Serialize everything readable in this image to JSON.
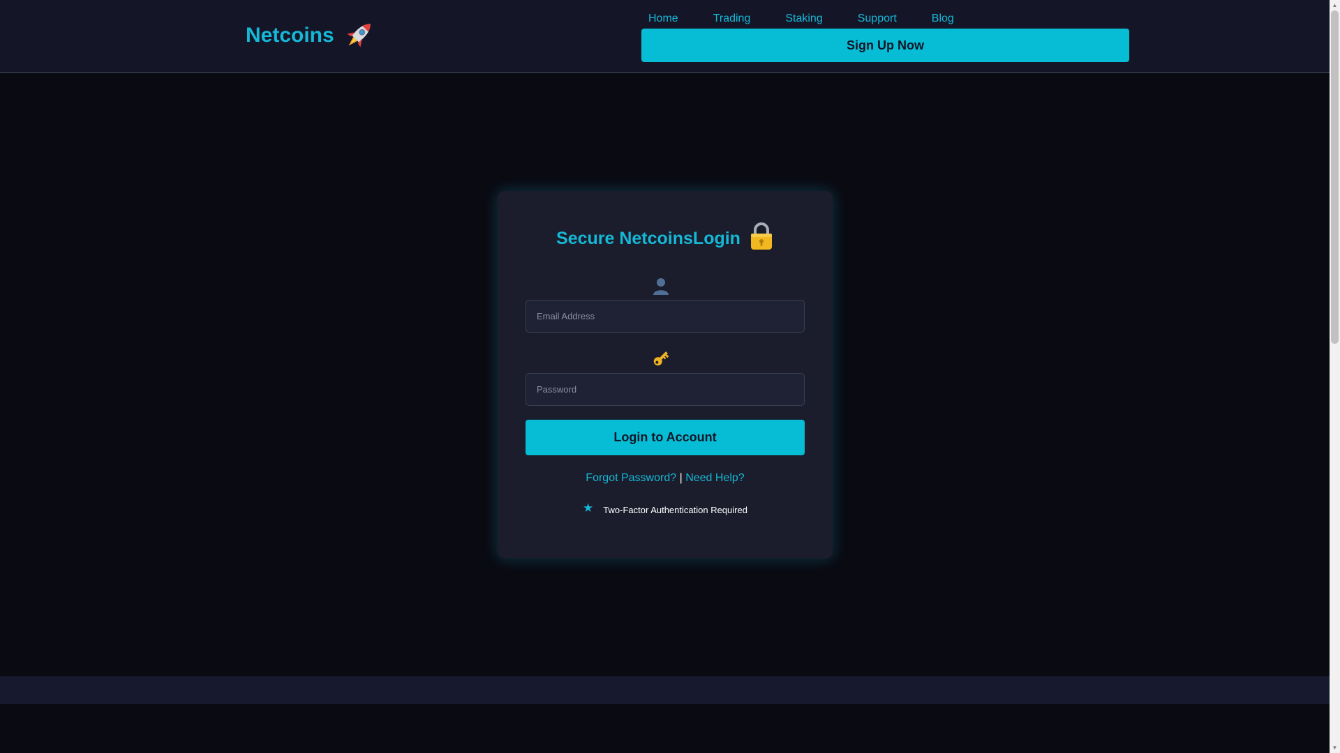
{
  "header": {
    "logo_text": "Netcoins",
    "nav": [
      "Home",
      "Trading",
      "Staking",
      "Support",
      "Blog"
    ],
    "signup_label": "Sign Up Now"
  },
  "login": {
    "title": "Secure NetcoinsLogin",
    "email_placeholder": "Email Address",
    "password_placeholder": "Password",
    "login_label": "Login to Account",
    "forgot_label": "Forgot Password?",
    "separator": "|",
    "help_label": "Need Help?",
    "tfa_text": "Two-Factor Authentication Required",
    "tfa_icon": "★"
  },
  "icons": {
    "logo": "rocket-icon",
    "title": "lock-icon",
    "email": "user-icon",
    "password": "key-icon",
    "tfa": "star-icon"
  },
  "colors": {
    "accent": "#15b8d6",
    "button": "#07bdd6",
    "header_bg": "#141628",
    "page_bg": "#0a0a12",
    "card_bg": "#1b1d2c"
  }
}
